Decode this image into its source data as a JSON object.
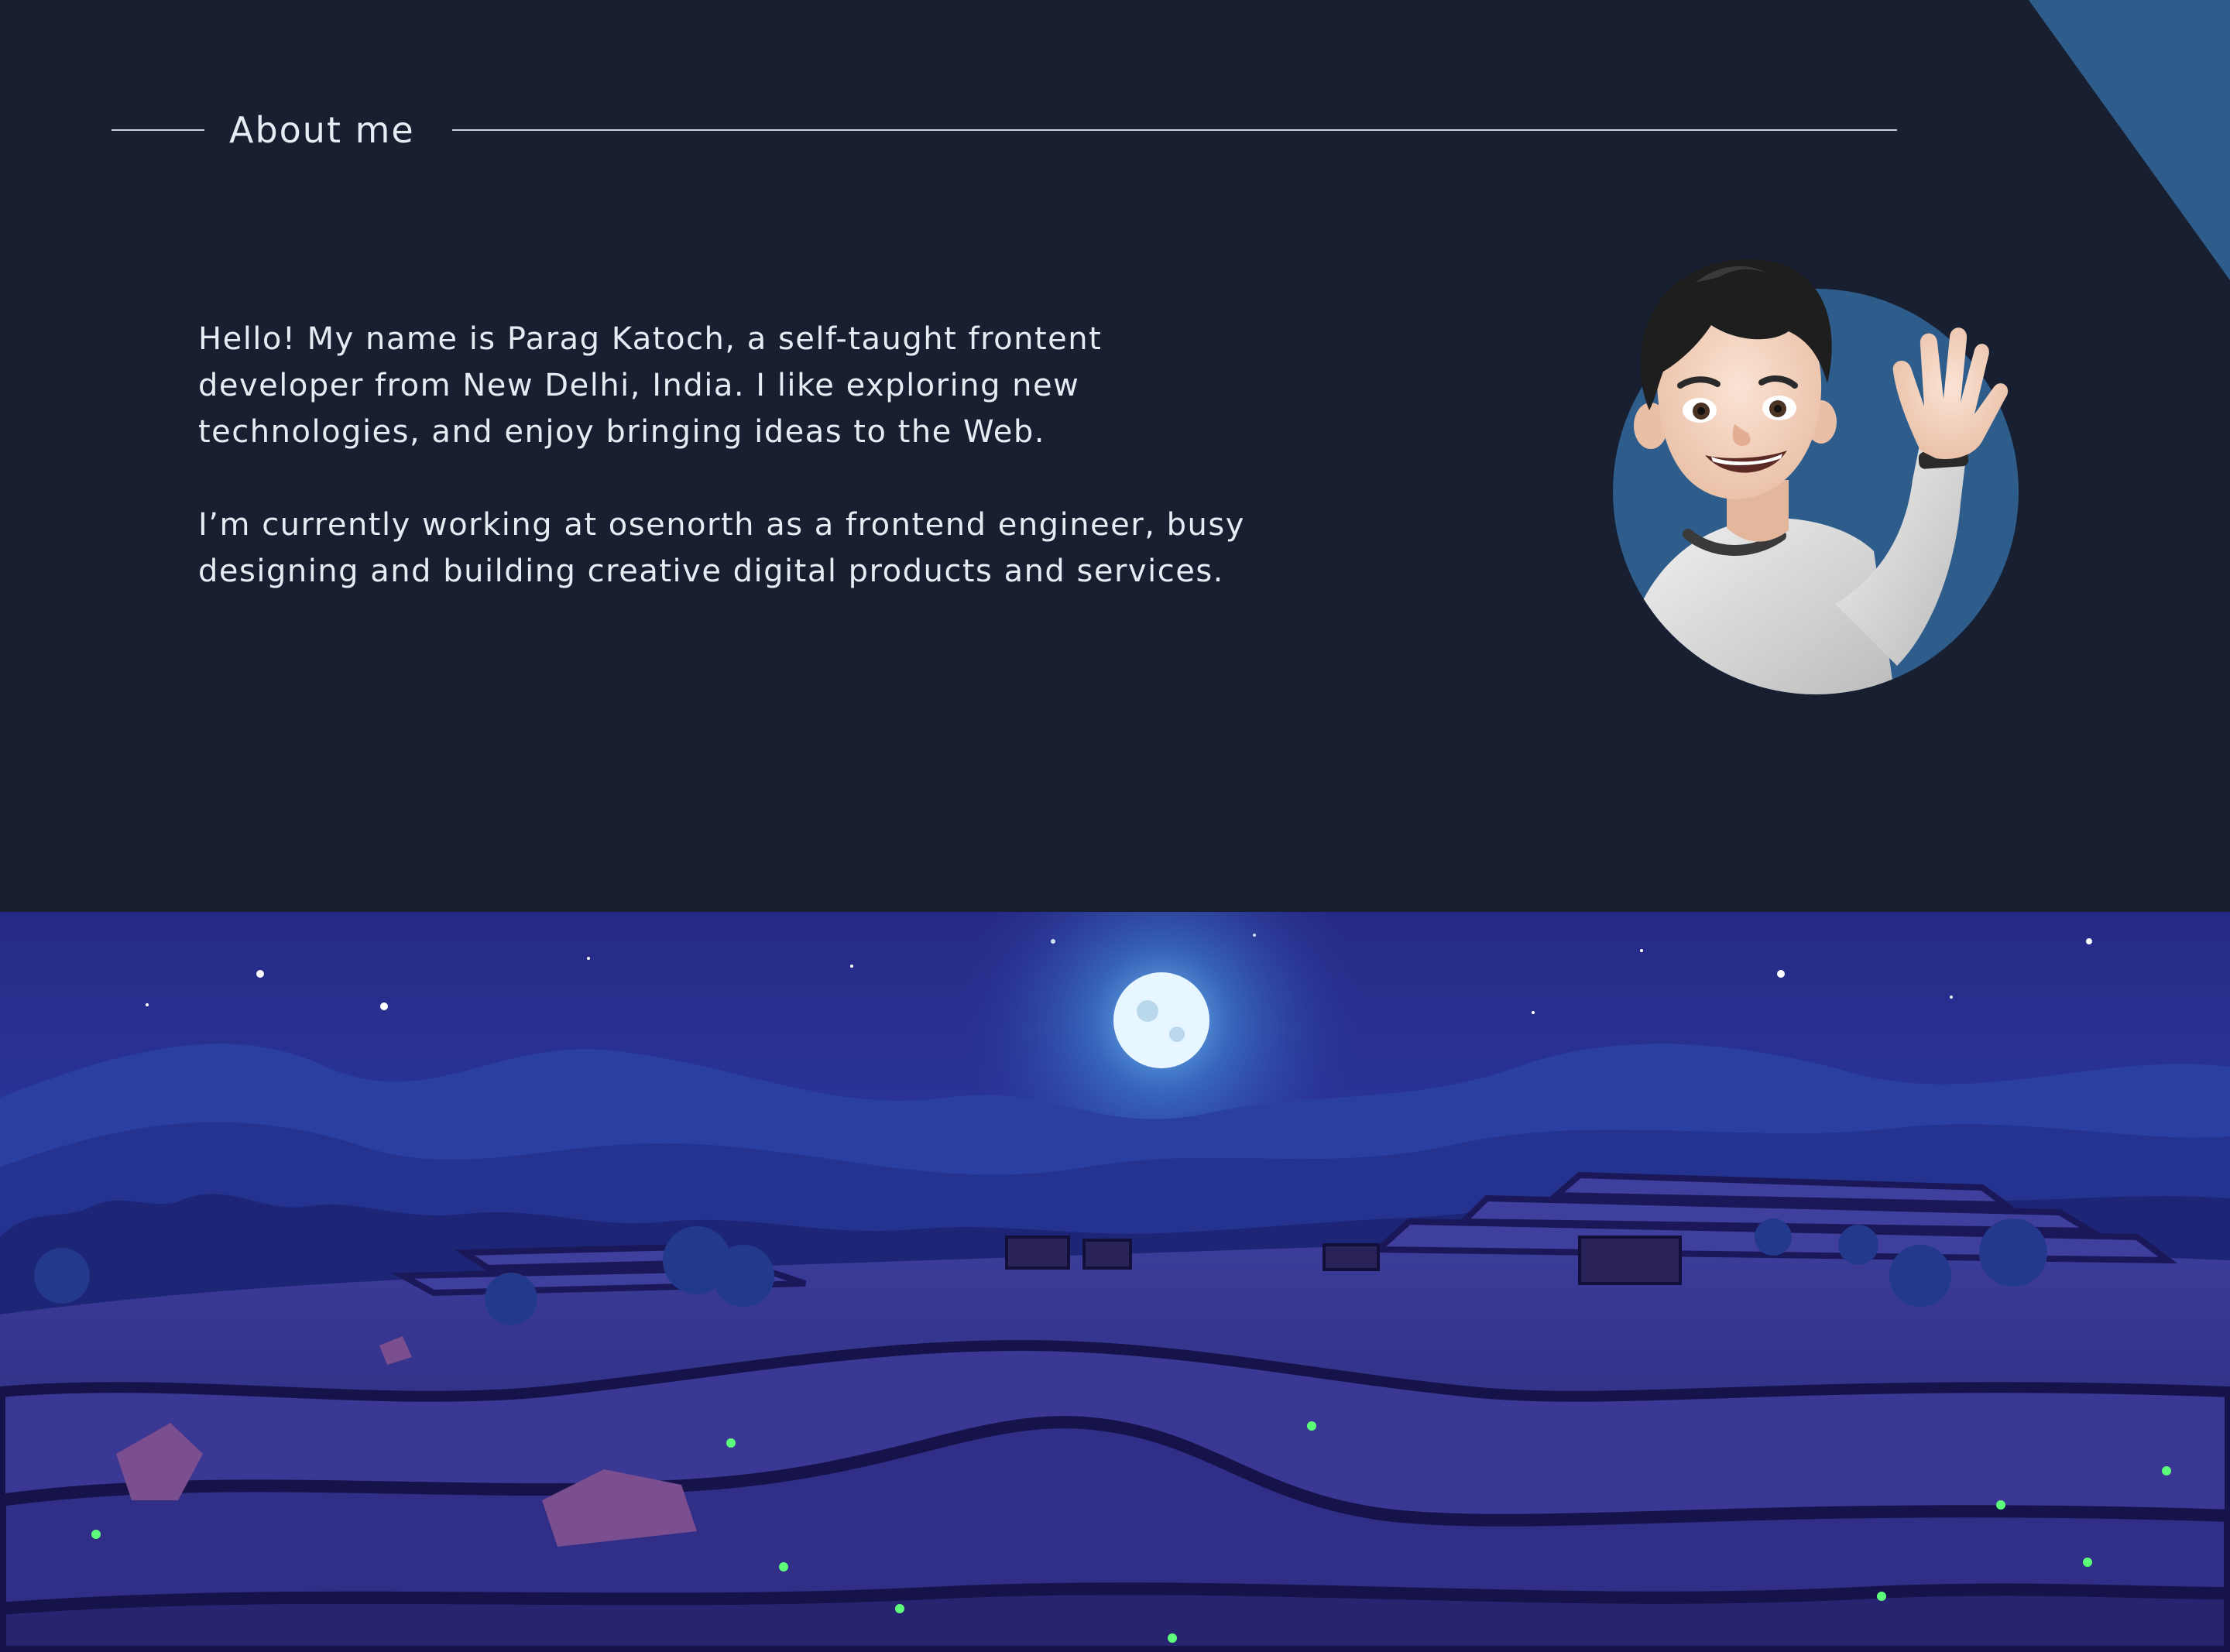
{
  "about": {
    "heading": "About me",
    "paragraphs": [
      "Hello! My name is Parag Katoch, a self-taught frontent developer from New Delhi, India. I like exploring new technologies, and enjoy bringing ideas to the Web.",
      "I’m currently working at osenorth as a frontend engineer, busy designing and building creative digital products and services."
    ]
  },
  "colors": {
    "background": "#171f30",
    "accent": "#2e5d8c",
    "text": "#e7ebf3"
  },
  "icons": {
    "avatar": "waving-memoji-avatar",
    "illustration": "night-rice-terrace-landscape"
  }
}
